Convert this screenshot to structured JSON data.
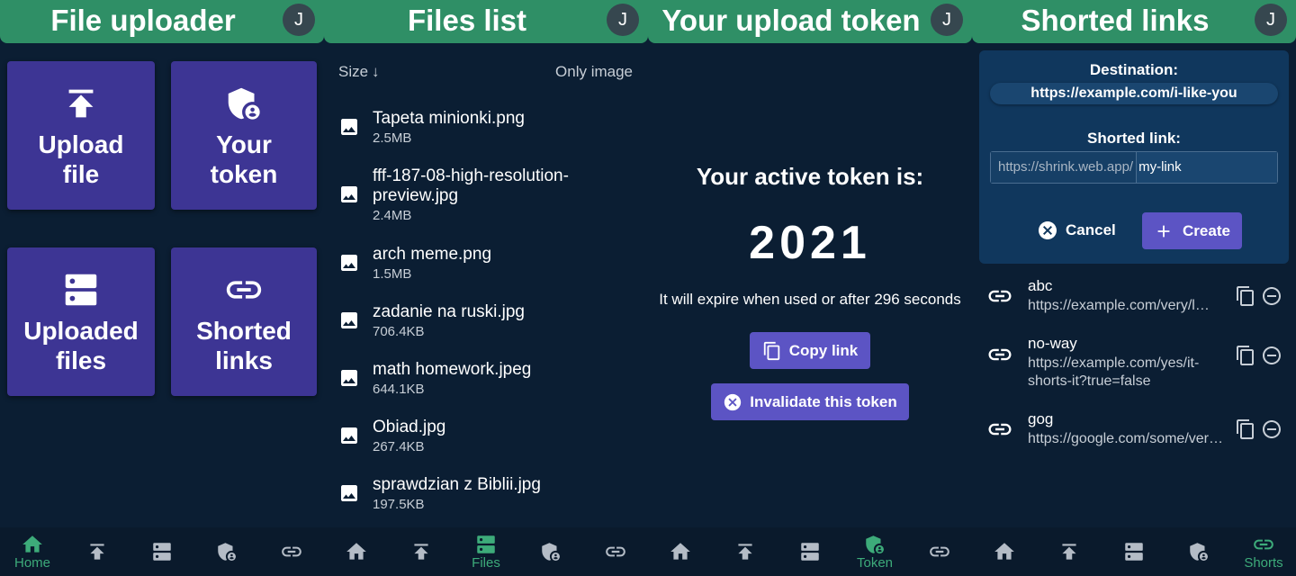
{
  "screens": {
    "home": {
      "title": "File uploader",
      "avatar": "J",
      "tiles": [
        {
          "label": "Upload file",
          "icon": "upload-icon"
        },
        {
          "label": "Your token",
          "icon": "shield-user-icon"
        },
        {
          "label": "Uploaded files",
          "icon": "storage-icon"
        },
        {
          "label": "Shorted links",
          "icon": "link-icon"
        }
      ]
    },
    "files": {
      "title": "Files list",
      "avatar": "J",
      "sort_label": "Size",
      "sort_arrow": "↓",
      "filter_label": "Only image",
      "items": [
        {
          "name": "Tapeta minionki.png",
          "size": "2.5MB"
        },
        {
          "name": "fff-187-08-high-resolution-preview.jpg",
          "size": "2.4MB"
        },
        {
          "name": "arch meme.png",
          "size": "1.5MB"
        },
        {
          "name": "zadanie na ruski.jpg",
          "size": "706.4KB"
        },
        {
          "name": "math homework.jpeg",
          "size": "644.1KB"
        },
        {
          "name": "Obiad.jpg",
          "size": "267.4KB"
        },
        {
          "name": "sprawdzian z Biblii.jpg",
          "size": "197.5KB"
        }
      ]
    },
    "token": {
      "title": "Your upload token",
      "avatar": "J",
      "heading": "Your active token is:",
      "value": "2021",
      "expire_text": "It will expire when used or after 296 seconds",
      "copy_label": "Copy link",
      "invalidate_label": "Invalidate this token"
    },
    "shorts": {
      "title": "Shorted links",
      "avatar": "J",
      "destination_label": "Destination:",
      "destination_value": "https://example.com/i-like-you",
      "short_label": "Shorted link:",
      "short_prefix": "https://shrink.web.app/",
      "short_value": "my-link",
      "cancel_label": "Cancel",
      "create_label": "Create",
      "links": [
        {
          "name": "abc",
          "url": "https://example.com/very/l…"
        },
        {
          "name": "no-way",
          "url": "https://example.com/yes/it-shorts-it?true=false"
        },
        {
          "name": "gog",
          "url": "https://google.com/some/ver…"
        }
      ]
    }
  },
  "nav": {
    "home_label": "Home",
    "files_label": "Files",
    "token_label": "Token",
    "shorts_label": "Shorts"
  },
  "colors": {
    "background": "#0b1e33",
    "header": "#2f8f66",
    "tile": "#3d3594",
    "button": "#5c54c4",
    "active_nav": "#3dab7a",
    "form_card": "#10375d"
  }
}
